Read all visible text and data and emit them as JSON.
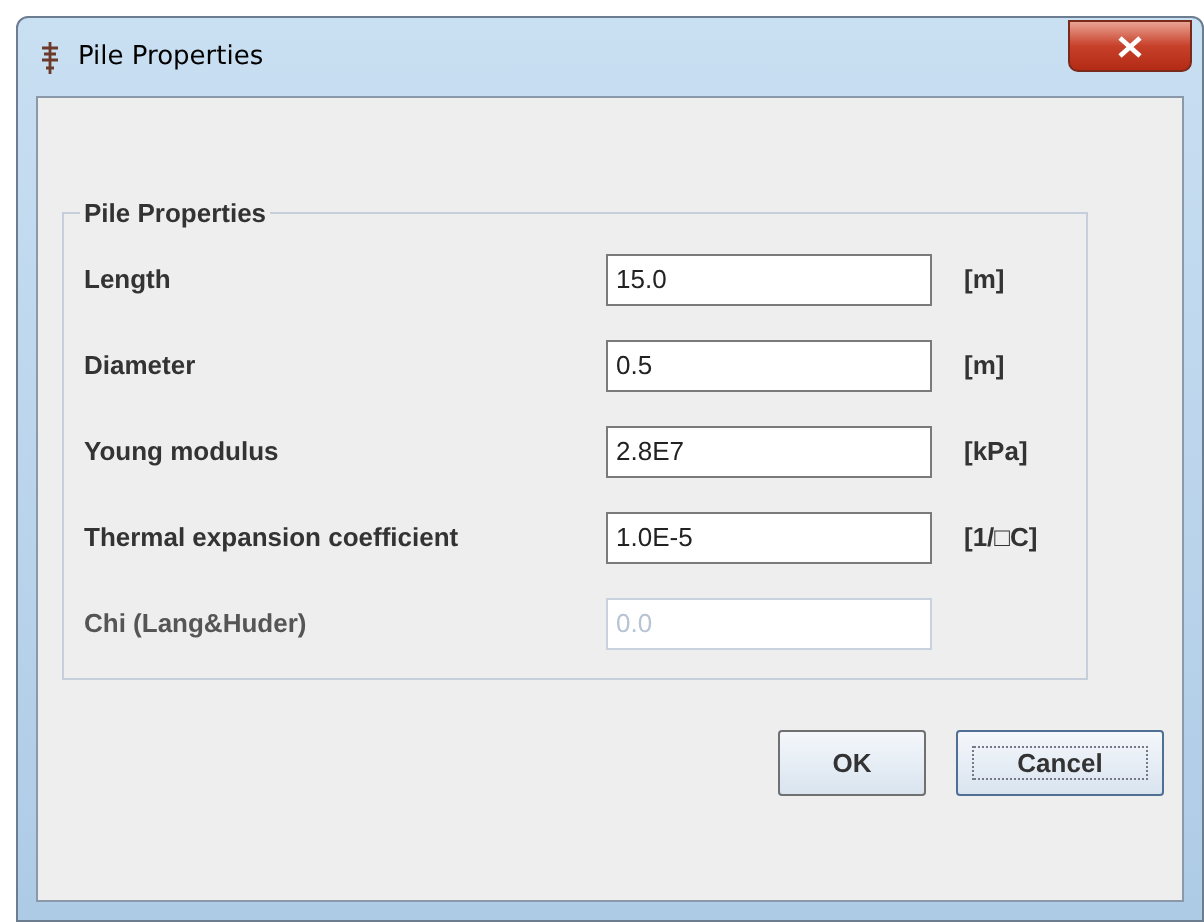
{
  "window": {
    "title": "Pile Properties"
  },
  "group": {
    "title": "Pile Properties",
    "rows": [
      {
        "label": "Length",
        "value": "15.0",
        "unit": "[m]",
        "disabled": false
      },
      {
        "label": "Diameter",
        "value": "0.5",
        "unit": "[m]",
        "disabled": false
      },
      {
        "label": "Young modulus",
        "value": "2.8E7",
        "unit": "[kPa]",
        "disabled": false
      },
      {
        "label": "Thermal expansion coefficient",
        "value": "1.0E-5",
        "unit": "[1/□C]",
        "disabled": false
      },
      {
        "label": "Chi (Lang&Huder)",
        "value": "0.0",
        "disabled": true
      }
    ]
  },
  "buttons": [
    {
      "label": "OK",
      "focused": false
    },
    {
      "label": "Cancel",
      "focused": true
    }
  ]
}
